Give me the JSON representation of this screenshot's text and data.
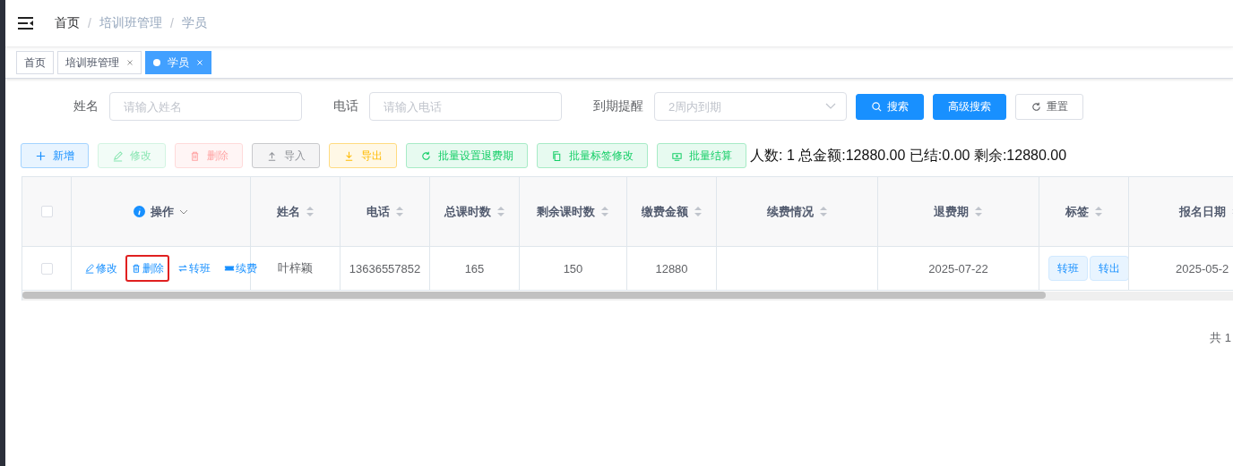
{
  "breadcrumb": [
    {
      "label": "首页",
      "link": true
    },
    {
      "separator": "/",
      "label": "培训班管理",
      "link": false
    },
    {
      "separator": "/",
      "label": "学员",
      "link": false
    }
  ],
  "tabs": [
    {
      "label": "首页",
      "selected": false,
      "closable": false
    },
    {
      "label": "培训班管理",
      "selected": false,
      "closable": true
    },
    {
      "label": "学员",
      "selected": true,
      "closable": true
    }
  ],
  "filters": [
    {
      "kind": "input",
      "label": "姓名",
      "placeholder": "请输入姓名"
    },
    {
      "kind": "input",
      "label": "电话",
      "placeholder": "请输入电话"
    },
    {
      "kind": "select",
      "label": "到期提醒",
      "placeholder": "2周内到期"
    }
  ],
  "filter_buttons": [
    {
      "label": "搜索",
      "kind": "primary"
    },
    {
      "label": "高级搜索",
      "kind": "primary"
    },
    {
      "label": "重置",
      "kind": "default"
    }
  ],
  "toolbar": [
    {
      "label": "新增",
      "kind": "primary",
      "disabled": false
    },
    {
      "label": "修改",
      "kind": "success",
      "disabled": true
    },
    {
      "label": "删除",
      "kind": "danger",
      "disabled": true
    },
    {
      "label": "导入",
      "kind": "info",
      "disabled": false
    },
    {
      "label": "导出",
      "kind": "warning",
      "disabled": false
    },
    {
      "label": "批量设置退费期",
      "kind": "success",
      "disabled": false
    },
    {
      "label": "批量标签修改",
      "kind": "success",
      "disabled": false
    },
    {
      "label": "批量结算",
      "kind": "success",
      "disabled": false
    }
  ],
  "summary": "人数: 1 总金额:12880.00 已结:0.00 剩余:12880.00",
  "table": {
    "header_checked": false,
    "columns": [
      {
        "kind": "actions",
        "label": "操作"
      },
      {
        "kind": "text",
        "label": "姓名"
      },
      {
        "kind": "text",
        "label": "电话"
      },
      {
        "kind": "text",
        "label": "总课时数"
      },
      {
        "kind": "text",
        "label": "剩余课时数"
      },
      {
        "kind": "text",
        "label": "缴费金额"
      },
      {
        "kind": "text",
        "label": "续费情况"
      },
      {
        "kind": "text",
        "label": "退费期"
      },
      {
        "kind": "tags",
        "label": "标签"
      },
      {
        "kind": "text",
        "label": "报名日期"
      }
    ],
    "rows": [
      {
        "checked": false,
        "actions": [
          {
            "label": "修改",
            "highlighted": false
          },
          {
            "label": "删除",
            "highlighted": true
          },
          {
            "label": "转班",
            "highlighted": false
          },
          {
            "label": "续费",
            "highlighted": false
          }
        ],
        "cells": [
          null,
          "叶梓颖",
          "13636557852",
          "165",
          "150",
          "12880",
          null,
          "2025-07-22",
          [
            "转班",
            "转出"
          ],
          "2025-05-2"
        ]
      }
    ]
  },
  "pagination": {
    "total": "共 1"
  }
}
